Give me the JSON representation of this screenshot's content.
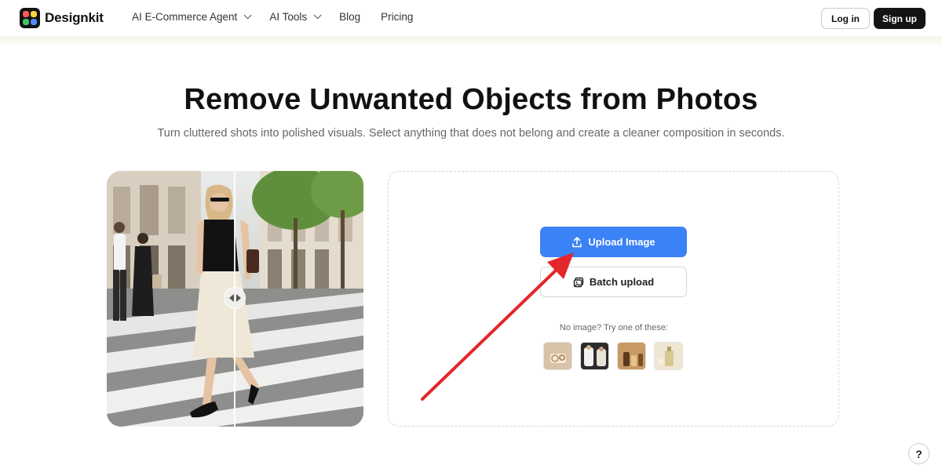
{
  "header": {
    "brand": "Designkit",
    "nav": [
      {
        "label": "AI E-Commerce Agent",
        "has_dropdown": true
      },
      {
        "label": "AI Tools",
        "has_dropdown": true
      },
      {
        "label": "Blog",
        "has_dropdown": false
      },
      {
        "label": "Pricing",
        "has_dropdown": false
      }
    ],
    "login_label": "Log in",
    "signup_label": "Sign up"
  },
  "hero": {
    "title": "Remove Unwanted Objects from Photos",
    "subtitle": "Turn cluttered shots into polished visuals. Select anything that does not belong and create a cleaner composition in seconds."
  },
  "upload": {
    "upload_label": "Upload Image",
    "batch_label": "Batch upload",
    "try_text": "No image? Try one of these:",
    "sample_icons": [
      "sample-jewelry",
      "sample-fashion",
      "sample-bottles",
      "sample-perfume"
    ]
  },
  "help_label": "?",
  "colors": {
    "primary_button": "#3b82f6",
    "signup_bg": "#141414",
    "annotation_arrow": "#e3262b",
    "header_strip": "#f1f8e8"
  }
}
